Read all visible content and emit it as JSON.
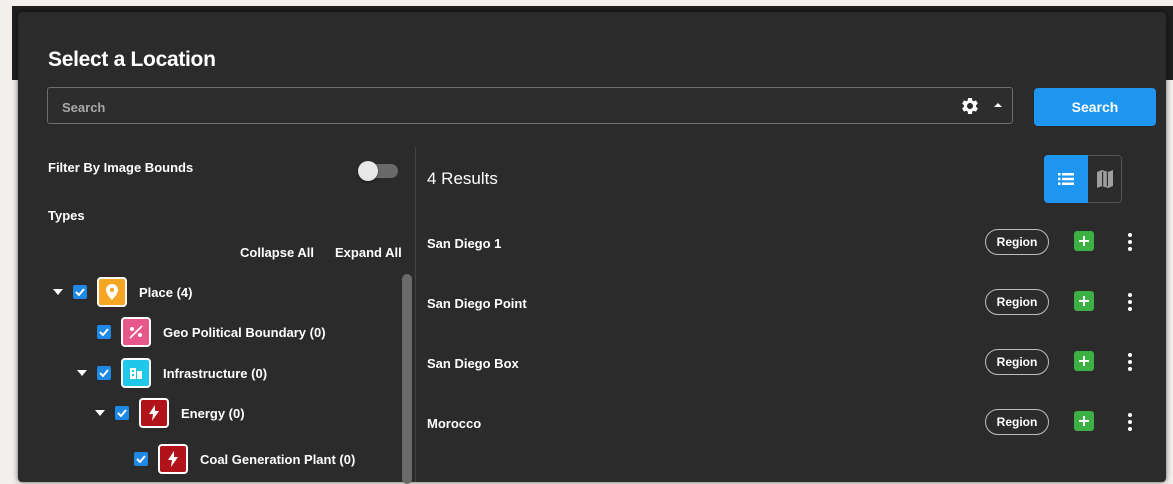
{
  "dialog": {
    "title": "Select a Location",
    "search": {
      "placeholder": "Search",
      "value": ""
    },
    "search_button_label": "Search",
    "settings_icon": "gear-icon",
    "options_icon": "caret-up-icon"
  },
  "filters": {
    "filter_by_image_bounds_label": "Filter By Image Bounds",
    "filter_by_image_bounds_enabled": false,
    "types_label": "Types",
    "collapse_all_label": "Collapse All",
    "expand_all_label": "Expand All"
  },
  "types_tree": [
    {
      "label": "Place (4)",
      "checked": true,
      "expanded": true,
      "icon": "map-pin-icon",
      "color": "#f5a623"
    },
    {
      "label": "Geo Political Boundary (0)",
      "checked": true,
      "icon": "boundary-icon",
      "color": "#e8578a"
    },
    {
      "label": "Infrastructure (0)",
      "checked": true,
      "expanded": true,
      "icon": "building-icon",
      "color": "#1fc8e8"
    },
    {
      "label": "Energy (0)",
      "checked": true,
      "expanded": true,
      "icon": "lightning-icon",
      "color": "#b0131a"
    },
    {
      "label": "Coal Generation Plant (0)",
      "checked": true,
      "icon": "lightning-icon",
      "color": "#b0131a"
    }
  ],
  "results": {
    "count_label": "4 Results",
    "view_mode": "list",
    "items": [
      {
        "name": "San Diego 1",
        "type": "Region"
      },
      {
        "name": "San Diego Point",
        "type": "Region"
      },
      {
        "name": "San Diego Box",
        "type": "Region"
      },
      {
        "name": "Morocco",
        "type": "Region"
      }
    ]
  },
  "colors": {
    "accent": "#1e96f0",
    "background": "#2b2b2b",
    "add_green": "#3cb043"
  }
}
